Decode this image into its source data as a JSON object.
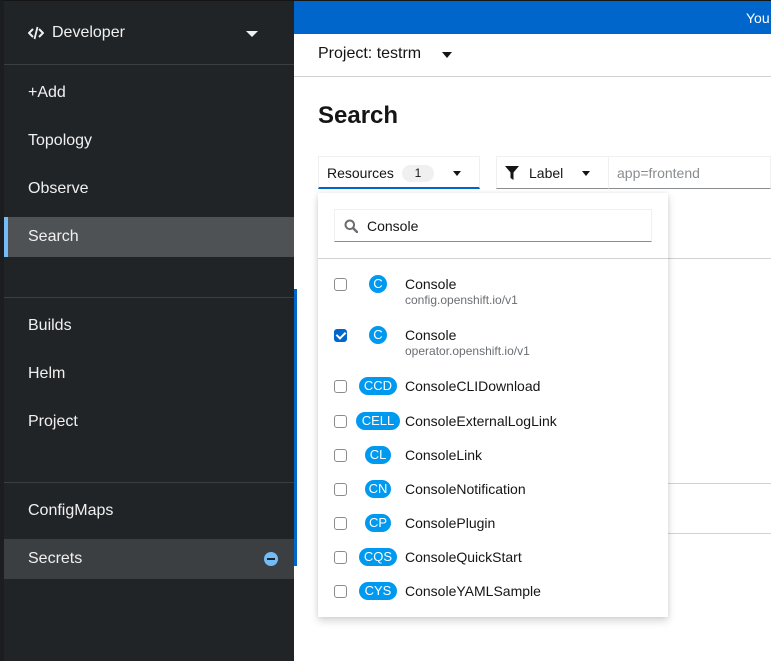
{
  "sidebar": {
    "perspective": {
      "label": "Developer",
      "icon": "code-icon"
    },
    "groups": [
      [
        {
          "label": "+Add"
        },
        {
          "label": "Topology"
        },
        {
          "label": "Observe"
        },
        {
          "label": "Search",
          "active": true
        }
      ],
      [
        {
          "label": "Builds"
        },
        {
          "label": "Helm"
        },
        {
          "label": "Project"
        }
      ],
      [
        {
          "label": "ConfigMaps"
        },
        {
          "label": "Secrets",
          "action_icon": "remove-icon"
        }
      ]
    ]
  },
  "banner": {
    "text": "You"
  },
  "project": {
    "label": "Project: testrm"
  },
  "page": {
    "title": "Search"
  },
  "filters": {
    "resources": {
      "label": "Resources",
      "count": "1"
    },
    "label_filter": {
      "label": "Label",
      "icon": "filter-icon"
    },
    "label_input": {
      "placeholder": "app=frontend",
      "value": ""
    }
  },
  "menu": {
    "search": {
      "value": "Console",
      "icon": "search-icon"
    },
    "options": [
      {
        "abbr": "C",
        "name": "Console",
        "group": "config.openshift.io/v1",
        "checked": false
      },
      {
        "abbr": "C",
        "name": "Console",
        "group": "operator.openshift.io/v1",
        "checked": true
      },
      {
        "abbr": "CCD",
        "name": "ConsoleCLIDownload",
        "group": "",
        "checked": false
      },
      {
        "abbr": "CELL",
        "name": "ConsoleExternalLogLink",
        "group": "",
        "checked": false
      },
      {
        "abbr": "CL",
        "name": "ConsoleLink",
        "group": "",
        "checked": false
      },
      {
        "abbr": "CN",
        "name": "ConsoleNotification",
        "group": "",
        "checked": false
      },
      {
        "abbr": "CP",
        "name": "ConsolePlugin",
        "group": "",
        "checked": false
      },
      {
        "abbr": "CQS",
        "name": "ConsoleQuickStart",
        "group": "",
        "checked": false
      },
      {
        "abbr": "CYS",
        "name": "ConsoleYAMLSample",
        "group": "",
        "checked": false
      }
    ]
  },
  "colors": {
    "accent": "#0066cc",
    "sidebar_bg": "#212427",
    "active_indicator": "#73bcf7",
    "kind_badge": "#0099f0"
  }
}
